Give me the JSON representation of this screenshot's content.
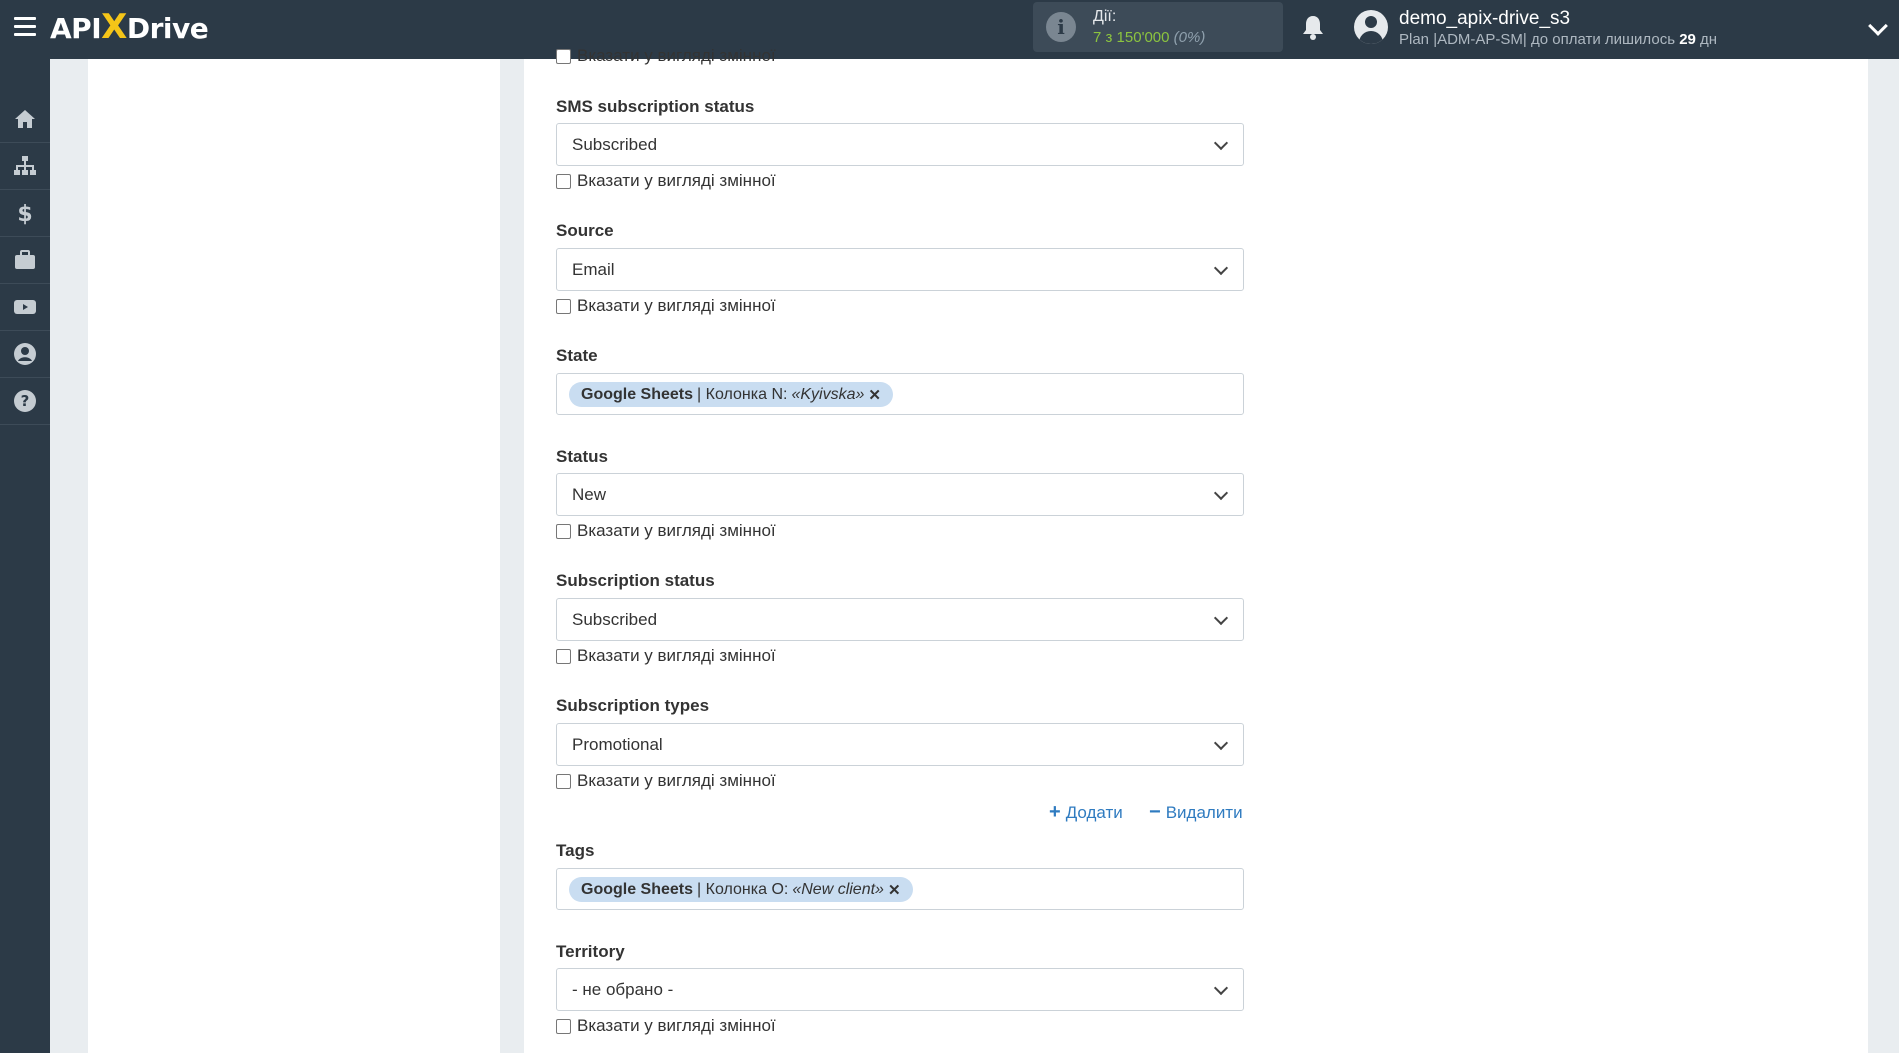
{
  "header": {
    "logo_api": "API",
    "logo_x": "X",
    "logo_drive": "Drive",
    "actions_label": "Дії:",
    "actions_value": "7 з 150'000",
    "actions_percent": "(0%)",
    "username": "demo_apix-drive_s3",
    "plan_prefix": "Plan |ADM-AP-SM| до оплати лишилось",
    "plan_days": "29",
    "plan_suffix": "дн"
  },
  "sidebar": {
    "items": [
      "home-icon",
      "sitemap-icon",
      "dollar-icon",
      "briefcase-icon",
      "video-icon",
      "user-icon",
      "help-icon"
    ]
  },
  "form": {
    "clipped_checkbox_label": "Вказати у вигляді змінної",
    "checkbox_label": "Вказати у вигляді змінної",
    "sms_subscription_status": {
      "label": "SMS subscription status",
      "value": "Subscribed"
    },
    "source": {
      "label": "Source",
      "value": "Email"
    },
    "state": {
      "label": "State",
      "chip_source": "Google Sheets",
      "chip_column": "| Колонка N:",
      "chip_value": "«Kyivska»"
    },
    "status": {
      "label": "Status",
      "value": "New"
    },
    "subscription_status": {
      "label": "Subscription status",
      "value": "Subscribed"
    },
    "subscription_types": {
      "label": "Subscription types",
      "value": "Promotional"
    },
    "add_label": "Додати",
    "remove_label": "Видалити",
    "tags": {
      "label": "Tags",
      "chip_source": "Google Sheets",
      "chip_column": "| Колонка O:",
      "chip_value": "«New client»"
    },
    "territory": {
      "label": "Territory",
      "value": "- не обрано -"
    }
  },
  "colors": {
    "topbar": "#2c3a47",
    "accent_yellow": "#f5c518",
    "actions_green": "#8cc43f",
    "link_blue": "#2f7bc0",
    "chip_bg": "#c9ddf1"
  }
}
